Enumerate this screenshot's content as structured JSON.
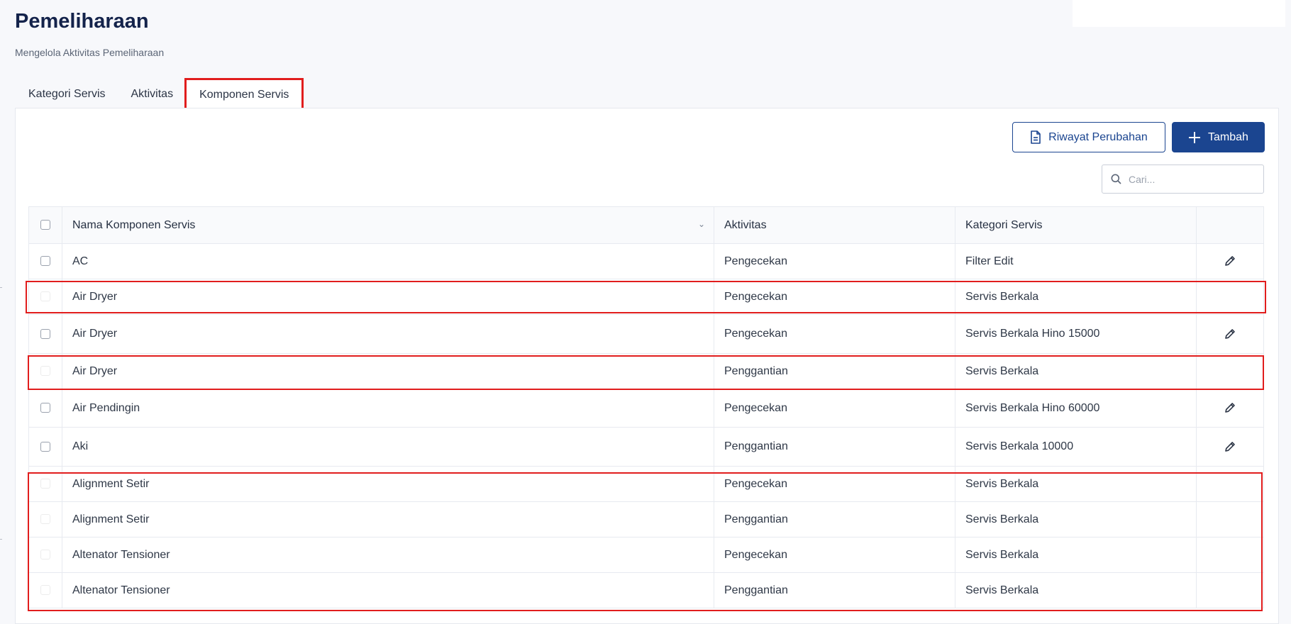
{
  "header": {
    "title": "Pemeliharaan",
    "subtitle": "Mengelola Aktivitas Pemeliharaan"
  },
  "tabs": [
    {
      "label": "Kategori Servis",
      "active": false
    },
    {
      "label": "Aktivitas",
      "active": false
    },
    {
      "label": "Komponen Servis",
      "active": true
    }
  ],
  "toolbar": {
    "history_label": "Riwayat Perubahan",
    "add_label": "Tambah"
  },
  "search": {
    "placeholder": "Cari..."
  },
  "table": {
    "columns": [
      "Nama Komponen Servis",
      "Aktivitas",
      "Kategori Servis"
    ],
    "rows": [
      {
        "name": "AC",
        "activity": "Pengecekan",
        "category": "Filter Edit",
        "editable": true
      },
      {
        "name": "Air Dryer",
        "activity": "Pengecekan",
        "category": "Servis Berkala",
        "editable": false
      },
      {
        "name": "Air Dryer",
        "activity": "Pengecekan",
        "category": "Servis Berkala Hino 15000",
        "editable": true
      },
      {
        "name": "Air Dryer",
        "activity": "Penggantian",
        "category": "Servis Berkala",
        "editable": false
      },
      {
        "name": "Air Pendingin",
        "activity": "Pengecekan",
        "category": "Servis Berkala Hino 60000",
        "editable": true
      },
      {
        "name": "Aki",
        "activity": "Penggantian",
        "category": "Servis Berkala 10000",
        "editable": true
      },
      {
        "name": "Alignment Setir",
        "activity": "Pengecekan",
        "category": "Servis Berkala",
        "editable": false
      },
      {
        "name": "Alignment Setir",
        "activity": "Penggantian",
        "category": "Servis Berkala",
        "editable": false
      },
      {
        "name": "Altenator Tensioner",
        "activity": "Pengecekan",
        "category": "Servis Berkala",
        "editable": false
      },
      {
        "name": "Altenator Tensioner",
        "activity": "Penggantian",
        "category": "Servis Berkala",
        "editable": false
      }
    ]
  },
  "colors": {
    "primary": "#1b4590",
    "highlight": "#e11d1d"
  },
  "icons": {
    "history": "document-icon",
    "add": "plus-icon",
    "search": "search-icon",
    "edit": "pencil-icon"
  }
}
